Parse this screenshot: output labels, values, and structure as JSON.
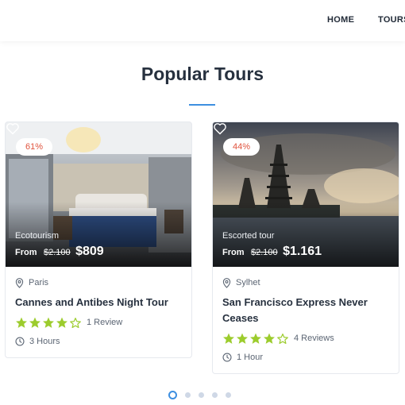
{
  "nav": {
    "items": [
      "HOME",
      "TOURS"
    ]
  },
  "section": {
    "title": "Popular Tours"
  },
  "colors": {
    "accent": "#3d8fe0",
    "star": "#9ccc2d",
    "discount": "#e0533d"
  },
  "cards": [
    {
      "discount": "61%",
      "category": "Ecotourism",
      "from_label": "From",
      "old_price": "$2.100",
      "new_price": "$809",
      "location": "Paris",
      "title": "Cannes and Antibes Night Tour",
      "rating": 4.5,
      "reviews": "1 Review",
      "duration": "3 Hours"
    },
    {
      "discount": "44%",
      "category": "Escorted tour",
      "from_label": "From",
      "old_price": "$2.100",
      "new_price": "$1.161",
      "location": "Sylhet",
      "title": "San Francisco Express Never Ceases",
      "rating": 4.5,
      "reviews": "4 Reviews",
      "duration": "1 Hour"
    }
  ],
  "pagination": {
    "count": 5,
    "active": 0
  }
}
